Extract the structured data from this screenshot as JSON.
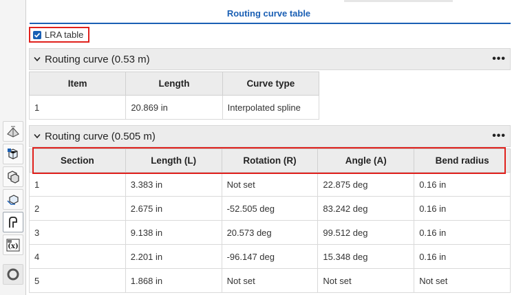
{
  "panel": {
    "title": "Routing curve table"
  },
  "lra": {
    "label": "LRA table",
    "checked": true
  },
  "section1": {
    "title": "Routing curve (0.53 m)",
    "more": "•••",
    "headers": [
      "Item",
      "Length",
      "Curve type"
    ],
    "rows": [
      [
        "1",
        "20.869 in",
        "Interpolated spline"
      ]
    ]
  },
  "section2": {
    "title": "Routing curve (0.505 m)",
    "more": "•••",
    "headers": [
      "Section",
      "Length (L)",
      "Rotation (R)",
      "Angle (A)",
      "Bend radius"
    ],
    "rows": [
      [
        "1",
        "3.383 in",
        "Not set",
        "22.875 deg",
        "0.16 in"
      ],
      [
        "2",
        "2.675 in",
        "-52.505 deg",
        "83.242 deg",
        "0.16 in"
      ],
      [
        "3",
        "9.138 in",
        "20.573 deg",
        "99.512 deg",
        "0.16 in"
      ],
      [
        "4",
        "2.201 in",
        "-96.147 deg",
        "15.348 deg",
        "0.16 in"
      ],
      [
        "5",
        "1.868 in",
        "Not set",
        "Not set",
        "Not set"
      ]
    ]
  },
  "toolbar": {
    "icons": [
      "sheet-metal-icon",
      "part-studio-icon",
      "assembly-icon",
      "derived-icon",
      "routing-curve-icon",
      "variable-icon",
      "circle-icon"
    ]
  },
  "colors": {
    "accent": "#1a5fb4",
    "highlight": "#e0201b",
    "header_bg": "#ececec"
  }
}
